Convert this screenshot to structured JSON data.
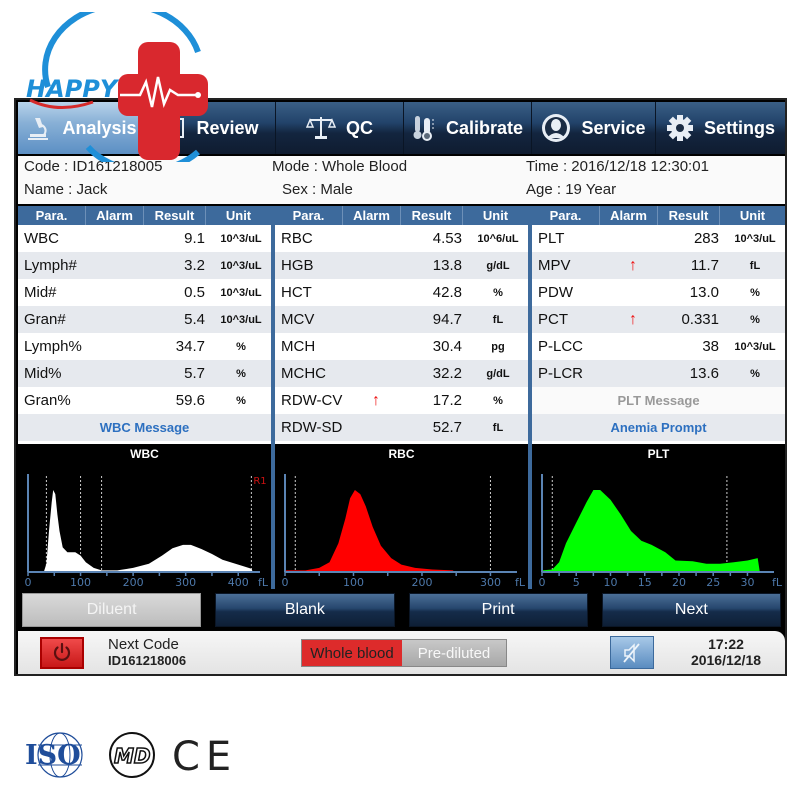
{
  "brand": {
    "logo_text": "HAPPY"
  },
  "tabs": [
    {
      "label": "Analysis",
      "icon": "microscope-icon",
      "active": true
    },
    {
      "label": "Review",
      "icon": "review-icon",
      "active": false
    },
    {
      "label": "QC",
      "icon": "balance-scale-icon",
      "active": false
    },
    {
      "label": "Calibrate",
      "icon": "thermometer-icon",
      "active": false
    },
    {
      "label": "Service",
      "icon": "user-icon",
      "active": false
    },
    {
      "label": "Settings",
      "icon": "gear-icon",
      "active": false
    }
  ],
  "sample": {
    "code": "Code : ID161218005",
    "mode": "Mode : Whole Blood",
    "time": "Time : 2016/12/18 12:30:01",
    "name": "Name : Jack",
    "sex": "Sex : Male",
    "age": "Age : 19 Year"
  },
  "columns": {
    "para": "Para.",
    "alarm": "Alarm",
    "result": "Result",
    "unit": "Unit"
  },
  "wbc_table": {
    "rows": [
      {
        "para": "WBC",
        "alarm": "",
        "result": "9.1",
        "unit": "10^3/uL"
      },
      {
        "para": "Lymph#",
        "alarm": "",
        "result": "3.2",
        "unit": "10^3/uL"
      },
      {
        "para": "Mid#",
        "alarm": "",
        "result": "0.5",
        "unit": "10^3/uL"
      },
      {
        "para": "Gran#",
        "alarm": "",
        "result": "5.4",
        "unit": "10^3/uL"
      },
      {
        "para": "Lymph%",
        "alarm": "",
        "result": "34.7",
        "unit": "%"
      },
      {
        "para": "Mid%",
        "alarm": "",
        "result": "5.7",
        "unit": "%"
      },
      {
        "para": "Gran%",
        "alarm": "",
        "result": "59.6",
        "unit": "%"
      }
    ],
    "message": "WBC Message"
  },
  "rbc_table": {
    "rows": [
      {
        "para": "RBC",
        "alarm": "",
        "result": "4.53",
        "unit": "10^6/uL"
      },
      {
        "para": "HGB",
        "alarm": "",
        "result": "13.8",
        "unit": "g/dL"
      },
      {
        "para": "HCT",
        "alarm": "",
        "result": "42.8",
        "unit": "%"
      },
      {
        "para": "MCV",
        "alarm": "",
        "result": "94.7",
        "unit": "fL"
      },
      {
        "para": "MCH",
        "alarm": "",
        "result": "30.4",
        "unit": "pg"
      },
      {
        "para": "MCHC",
        "alarm": "",
        "result": "32.2",
        "unit": "g/dL"
      },
      {
        "para": "RDW-CV",
        "alarm": "↑",
        "result": "17.2",
        "unit": "%"
      },
      {
        "para": "RDW-SD",
        "alarm": "",
        "result": "52.7",
        "unit": "fL"
      }
    ]
  },
  "plt_table": {
    "rows": [
      {
        "para": "PLT",
        "alarm": "",
        "result": "283",
        "unit": "10^3/uL"
      },
      {
        "para": "MPV",
        "alarm": "↑",
        "result": "11.7",
        "unit": "fL"
      },
      {
        "para": "PDW",
        "alarm": "",
        "result": "13.0",
        "unit": "%"
      },
      {
        "para": "PCT",
        "alarm": "↑",
        "result": "0.331",
        "unit": "%"
      },
      {
        "para": "P-LCC",
        "alarm": "",
        "result": "38",
        "unit": "10^3/uL"
      },
      {
        "para": "P-LCR",
        "alarm": "",
        "result": "13.6",
        "unit": "%"
      }
    ],
    "message": "PLT Message",
    "prompt": "Anemia Prompt"
  },
  "histograms": {
    "wbc": {
      "title": "WBC",
      "color": "#ffffff",
      "unit": "fL",
      "ticks": [
        "0",
        "100",
        "200",
        "300",
        "400"
      ],
      "xmax": 430,
      "discriminators": [
        35,
        100,
        140,
        425
      ],
      "marker": "R1",
      "curve": [
        [
          0,
          0
        ],
        [
          30,
          0
        ],
        [
          35,
          0.1
        ],
        [
          40,
          0.5
        ],
        [
          45,
          0.85
        ],
        [
          48,
          1.0
        ],
        [
          52,
          0.95
        ],
        [
          56,
          0.7
        ],
        [
          60,
          0.5
        ],
        [
          66,
          0.3
        ],
        [
          75,
          0.24
        ],
        [
          90,
          0.24
        ],
        [
          100,
          0.2
        ],
        [
          110,
          0.12
        ],
        [
          125,
          0.05
        ],
        [
          140,
          0.02
        ],
        [
          170,
          0.02
        ],
        [
          200,
          0.05
        ],
        [
          230,
          0.1
        ],
        [
          255,
          0.2
        ],
        [
          275,
          0.29
        ],
        [
          295,
          0.33
        ],
        [
          310,
          0.33
        ],
        [
          330,
          0.28
        ],
        [
          350,
          0.22
        ],
        [
          370,
          0.15
        ],
        [
          390,
          0.11
        ],
        [
          410,
          0.07
        ],
        [
          425,
          0.04
        ],
        [
          428,
          0
        ]
      ]
    },
    "rbc": {
      "title": "RBC",
      "color": "#ff0000",
      "unit": "fL",
      "ticks": [
        "0",
        "100",
        "200",
        "300"
      ],
      "xmax": 330,
      "discriminators": [
        15,
        300
      ],
      "curve": [
        [
          0,
          0.02
        ],
        [
          30,
          0.02
        ],
        [
          50,
          0.05
        ],
        [
          65,
          0.12
        ],
        [
          78,
          0.35
        ],
        [
          88,
          0.65
        ],
        [
          95,
          0.9
        ],
        [
          102,
          1.0
        ],
        [
          110,
          0.95
        ],
        [
          118,
          0.8
        ],
        [
          128,
          0.55
        ],
        [
          140,
          0.32
        ],
        [
          155,
          0.17
        ],
        [
          170,
          0.09
        ],
        [
          190,
          0.05
        ],
        [
          215,
          0.03
        ],
        [
          245,
          0.02
        ],
        [
          248,
          0
        ]
      ]
    },
    "plt": {
      "title": "PLT",
      "color": "#00ff00",
      "unit": "fL",
      "ticks": [
        "0",
        "5",
        "10",
        "15",
        "20",
        "25",
        "30"
      ],
      "xmax": 33,
      "discriminators": [
        1.5,
        27
      ],
      "curve": [
        [
          0,
          0.02
        ],
        [
          1.5,
          0.03
        ],
        [
          2.5,
          0.12
        ],
        [
          3.5,
          0.35
        ],
        [
          5,
          0.6
        ],
        [
          6.5,
          0.85
        ],
        [
          7.5,
          1.0
        ],
        [
          8.5,
          1.0
        ],
        [
          10,
          0.88
        ],
        [
          11.5,
          0.7
        ],
        [
          13,
          0.5
        ],
        [
          14.5,
          0.38
        ],
        [
          16,
          0.33
        ],
        [
          18,
          0.24
        ],
        [
          19.5,
          0.14
        ],
        [
          22,
          0.13
        ],
        [
          24,
          0.1
        ],
        [
          26,
          0.1
        ],
        [
          28,
          0.12
        ],
        [
          30,
          0.14
        ],
        [
          31.5,
          0.17
        ],
        [
          31.8,
          0
        ]
      ]
    }
  },
  "actions": [
    {
      "label": "Diluent",
      "enabled": false
    },
    {
      "label": "Blank",
      "enabled": true
    },
    {
      "label": "Print",
      "enabled": true
    },
    {
      "label": "Next",
      "enabled": true
    }
  ],
  "status": {
    "next_code_label": "Next Code",
    "next_code_value": "ID161218006",
    "mode_whole_blood": "Whole blood",
    "mode_prediluted": "Pre-diluted",
    "clock_time": "17:22",
    "clock_date": "2016/12/18"
  },
  "certifications": {
    "iso": "ISO",
    "md": "MD",
    "ce": "CE"
  },
  "colors": {
    "tab_active": "#88b0d6",
    "header_blue": "#3d6a9c",
    "alarm_red": "#ee1111",
    "link_blue": "#2d70c0"
  }
}
